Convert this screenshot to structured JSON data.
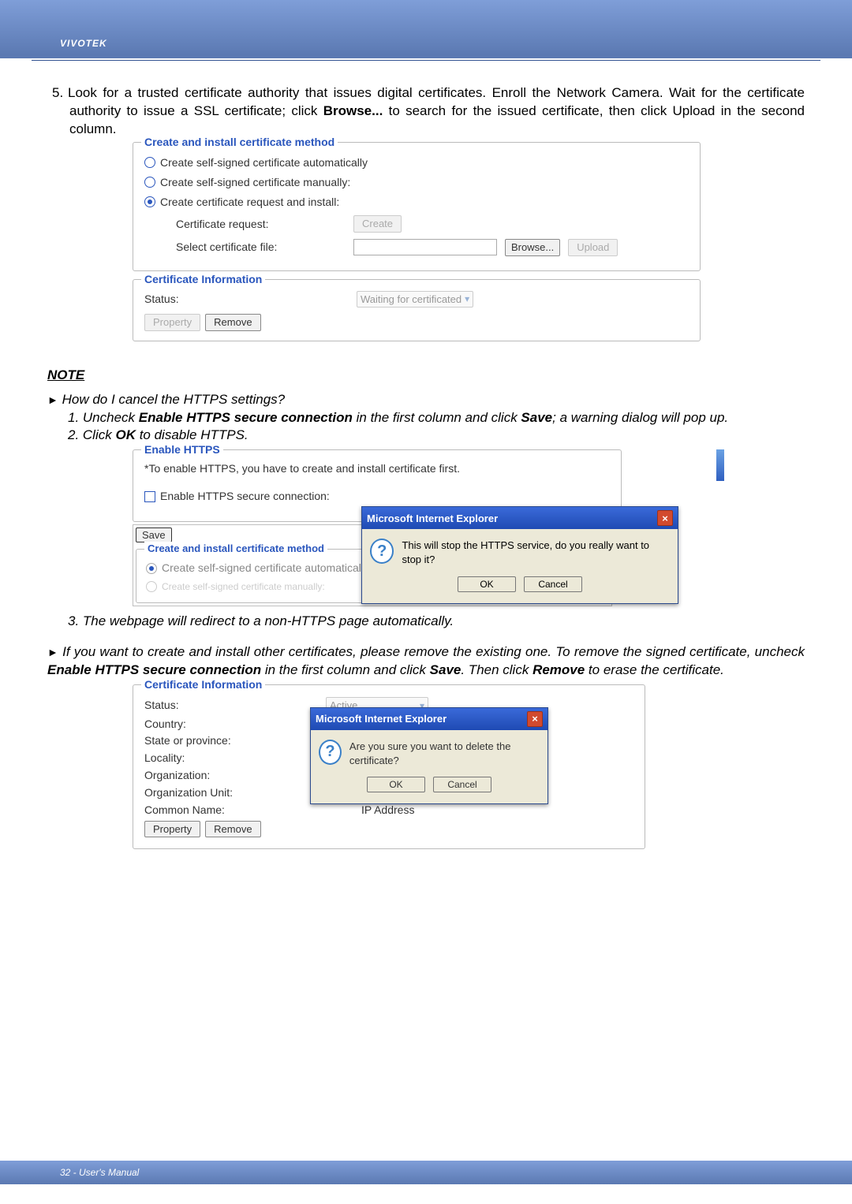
{
  "brand": "VIVOTEK",
  "step": {
    "num": "5.",
    "text_a": "Look for a trusted certificate authority that issues digital certificates. Enroll the Network Camera. Wait for the certificate authority to issue a SSL certificate; click ",
    "text_b": "Browse...",
    "text_c": " to search for the issued certificate, then click Upload in the second column."
  },
  "method_panel": {
    "legend": "Create and install certificate method",
    "opt_auto": "Create self-signed certificate automatically",
    "opt_manual": "Create self-signed certificate manually:",
    "opt_request": "Create certificate request and install:",
    "cert_request_label": "Certificate request:",
    "create_btn": "Create",
    "select_file_label": "Select certificate file:",
    "browse_btn": "Browse...",
    "upload_btn": "Upload"
  },
  "cert_info1": {
    "legend": "Certificate Information",
    "status_label": "Status:",
    "status_value": "Waiting for certificated",
    "property_btn": "Property",
    "remove_btn": "Remove"
  },
  "note_title": "NOTE",
  "note1": {
    "q": " How do I cancel the HTTPS settings?",
    "s1_a": "1. Uncheck ",
    "s1_b": "Enable HTTPS secure connection",
    "s1_c": " in the first column and click ",
    "s1_d": "Save",
    "s1_e": "; a warning dialog will pop up.",
    "s2_a": "2. Click ",
    "s2_b": "OK",
    "s2_c": "  to disable HTTPS."
  },
  "enable_panel": {
    "legend": "Enable HTTPS",
    "note": "*To enable HTTPS, you have to create and install certificate first.",
    "checkbox_label": "Enable HTTPS secure connection:",
    "save_btn": "Save",
    "method_legend": "Create and install certificate method",
    "method_opt1": "Create self-signed certificate automatically",
    "method_opt2_partial": "Create self-signed certificate manually:"
  },
  "dialog1": {
    "title": "Microsoft Internet Explorer",
    "msg": "This will stop the HTTPS service, do you really want to stop it?",
    "ok": "OK",
    "cancel": "Cancel"
  },
  "note1_s3": "3. The webpage will redirect to a non-HTTPS page automatically.",
  "note2": {
    "line_a": " If you want to create and install other certificates, please remove the existing one. To remove the signed certificate, uncheck ",
    "line_b": "Enable HTTPS secure connection",
    "line_c": " in the first column and click ",
    "line_d": "Save",
    "line_e": ". Then click ",
    "line_f": "Remove",
    "line_g": " to erase the certificate."
  },
  "cert_info2": {
    "legend": "Certificate Information",
    "rows": {
      "status": "Status:",
      "status_val": "Active",
      "country": "Country:",
      "state": "State or province:",
      "locality": "Locality:",
      "org": "Organization:",
      "org_unit": "Organization Unit:",
      "common": "Common Name:",
      "common_val": "IP Address"
    },
    "property_btn": "Property",
    "remove_btn": "Remove"
  },
  "dialog2": {
    "title": "Microsoft Internet Explorer",
    "msg": "Are you sure you want to delete the certificate?",
    "ok": "OK",
    "cancel": "Cancel"
  },
  "footer": "32 - User's Manual"
}
